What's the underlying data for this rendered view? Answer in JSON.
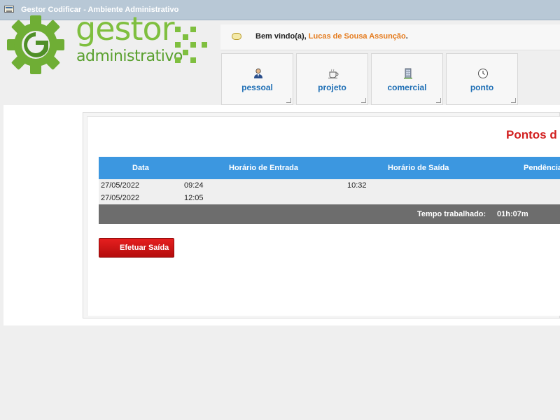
{
  "window": {
    "title": "Gestor Codificar - Ambiente Administrativo",
    "icon": "window-icon"
  },
  "logo": {
    "word1": "gestor",
    "word2": "administrativo"
  },
  "welcome": {
    "greeting": "Bem vindo(a),",
    "user": "Lucas de Sousa Assunção",
    "suffix": ".",
    "icon": "speech-bubble-icon"
  },
  "menu": [
    {
      "label": "pessoal",
      "icon": "person-icon"
    },
    {
      "label": "projeto",
      "icon": "coffee-cup-icon"
    },
    {
      "label": "comercial",
      "icon": "building-icon"
    },
    {
      "label": "ponto",
      "icon": "clock-icon"
    }
  ],
  "page": {
    "title": "Pontos d"
  },
  "table": {
    "headers": [
      "Data",
      "Horário de Entrada",
      "Horário de Saída",
      "Pendência"
    ],
    "rows": [
      {
        "date": "27/05/2022",
        "entry": "09:24",
        "exit": "10:32"
      },
      {
        "date": "27/05/2022",
        "entry": "12:05",
        "exit": ""
      }
    ],
    "summary": {
      "label": "Tempo trabalhado:",
      "value": "01h:07m"
    }
  },
  "actions": {
    "checkout_label": "Efetuar Saída"
  },
  "colors": {
    "accent_blue": "#3c97e0",
    "danger_red": "#d22020",
    "logo_green": "#7fbf3f",
    "user_orange": "#e47a1c"
  }
}
